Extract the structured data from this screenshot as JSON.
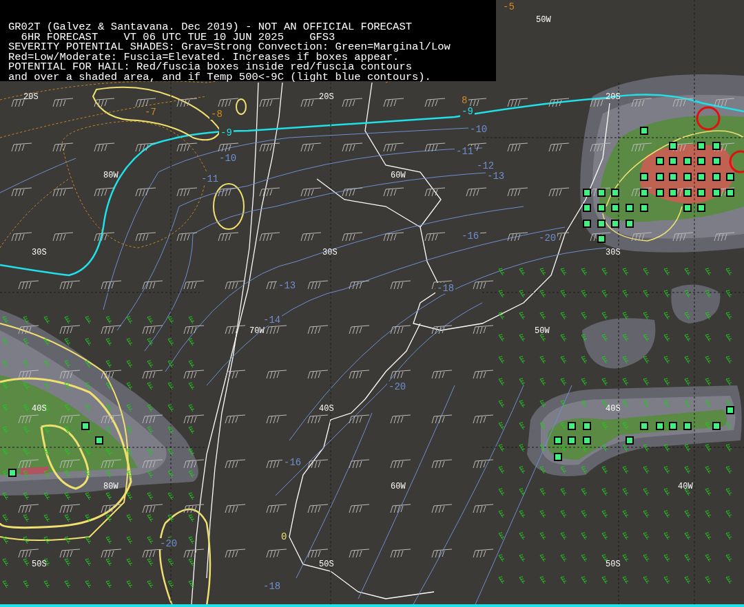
{
  "header": {
    "lines": [
      "GR02T (Galvez & Santavana. Dec 2019) - NOT AN OFFICIAL FORECAST",
      "  6HR FORECAST    VT 06 UTC TUE 10 JUN 2025    GFS3",
      "SEVERITY POTENTIAL SHADES: Grav=Strong Convection: Green=Marginal/Low",
      "Red=Low/Moderate: Fuscia=Elevated. Increases if boxes appear.",
      "POTENTIAL FOR HAIL: Red/fuscia boxes inside red/fuscia contours",
      "and over a shaded area, and if Temp 500<-9C (light blue contours)."
    ]
  },
  "grid_labels": [
    "50W",
    "20S",
    "20S",
    "20S",
    "80W",
    "60W",
    "30S",
    "30S",
    "30S",
    "70W",
    "50W",
    "40S",
    "40S",
    "40S",
    "80W",
    "60W",
    "40W",
    "50S",
    "50S",
    "50S"
  ],
  "contour_labels": [
    {
      "text": "-5",
      "kind": "dewpoint"
    },
    {
      "text": "-7",
      "kind": "dewpoint"
    },
    {
      "text": "-8",
      "kind": "dewpoint"
    },
    {
      "text": "-9",
      "kind": "cold"
    },
    {
      "text": "8",
      "kind": "dewpoint"
    },
    {
      "text": "-9",
      "kind": "cold"
    },
    {
      "text": "-10",
      "kind": "temp"
    },
    {
      "text": "-10",
      "kind": "temp"
    },
    {
      "text": "-11",
      "kind": "temp"
    },
    {
      "text": "-11",
      "kind": "temp"
    },
    {
      "text": "-12",
      "kind": "temp"
    },
    {
      "text": "-13",
      "kind": "temp"
    },
    {
      "text": "-16",
      "kind": "temp"
    },
    {
      "text": "-20",
      "kind": "temp"
    },
    {
      "text": "-13",
      "kind": "temp"
    },
    {
      "text": "-18",
      "kind": "temp"
    },
    {
      "text": "-14",
      "kind": "temp"
    },
    {
      "text": "-20",
      "kind": "temp"
    },
    {
      "text": "-16",
      "kind": "temp"
    },
    {
      "text": "-20",
      "kind": "temp"
    },
    {
      "text": "0",
      "kind": "severity"
    },
    {
      "text": "-18",
      "kind": "temp"
    }
  ]
}
